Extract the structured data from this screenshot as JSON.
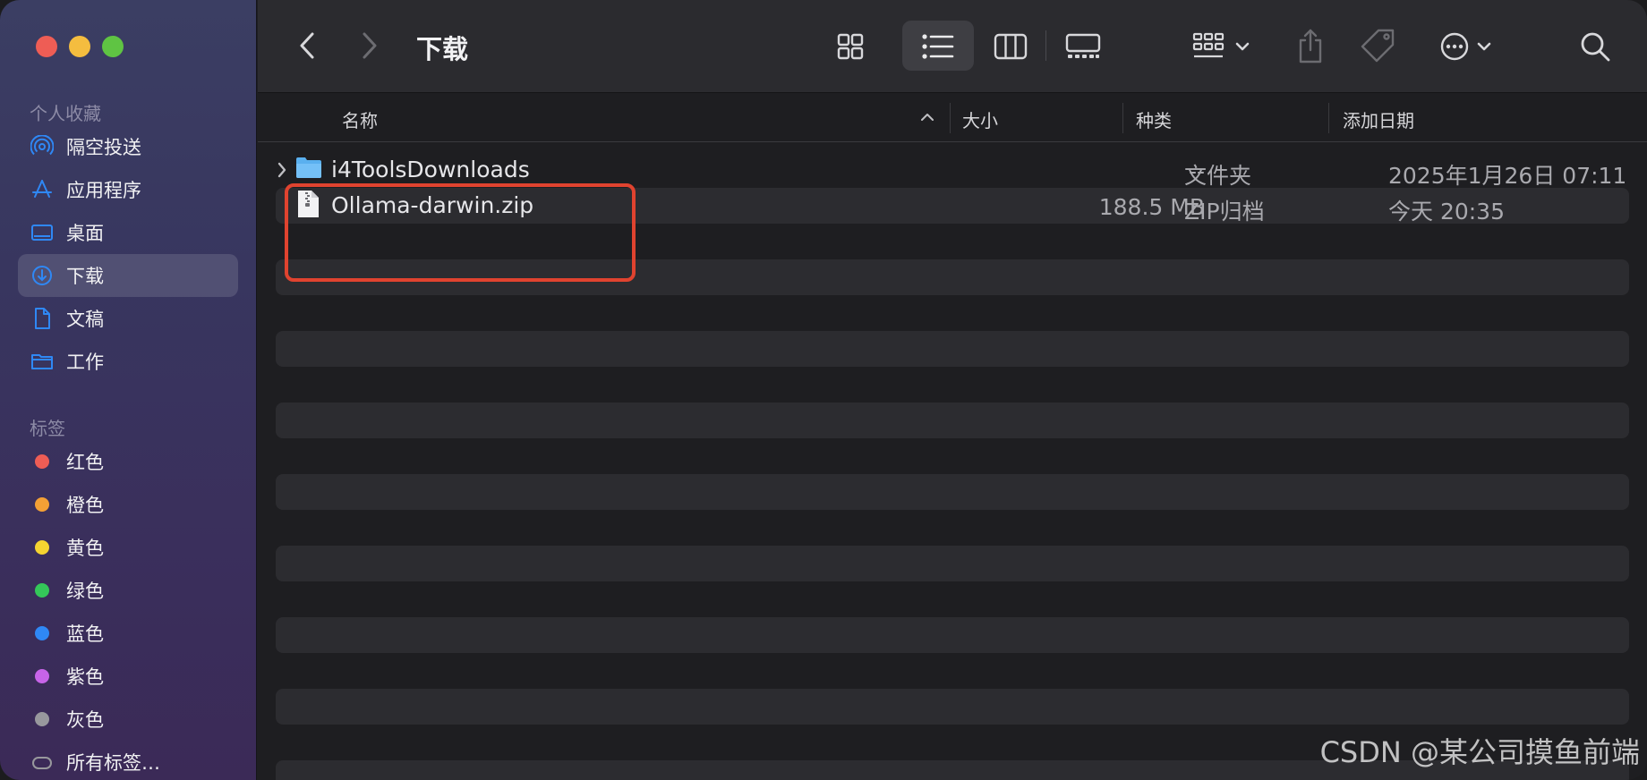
{
  "window": {
    "title": "下载"
  },
  "sidebar": {
    "favorites_label": "个人收藏",
    "favorites": [
      {
        "label": "隔空投送",
        "icon": "airdrop-icon"
      },
      {
        "label": "应用程序",
        "icon": "applications-icon"
      },
      {
        "label": "桌面",
        "icon": "desktop-icon"
      },
      {
        "label": "下载",
        "icon": "downloads-icon",
        "selected": true
      },
      {
        "label": "文稿",
        "icon": "document-icon"
      },
      {
        "label": "工作",
        "icon": "folder-icon"
      }
    ],
    "tags_label": "标签",
    "tags": [
      {
        "label": "红色",
        "color": "#ee5d55"
      },
      {
        "label": "橙色",
        "color": "#f3a035"
      },
      {
        "label": "黄色",
        "color": "#f5d431"
      },
      {
        "label": "绿色",
        "color": "#34c759"
      },
      {
        "label": "蓝色",
        "color": "#2f88f5"
      },
      {
        "label": "紫色",
        "color": "#c764e8"
      },
      {
        "label": "灰色",
        "color": "#98989d"
      }
    ],
    "all_tags_label": "所有标签…"
  },
  "columns": {
    "name": "名称",
    "size": "大小",
    "kind": "种类",
    "date_added": "添加日期"
  },
  "files": [
    {
      "name": "i4ToolsDownloads",
      "size": "--",
      "kind": "文件夹",
      "date": "2025年1月26日 07:11",
      "type": "folder"
    },
    {
      "name": "Ollama-darwin.zip",
      "size": "188.5 MB",
      "kind": "ZIP归档",
      "date": "今天 20:35",
      "type": "zip"
    }
  ],
  "watermark": "CSDN @某公司摸鱼前端",
  "colors": {
    "highlight_box": "#e0432f",
    "accent": "#2f88f5"
  }
}
